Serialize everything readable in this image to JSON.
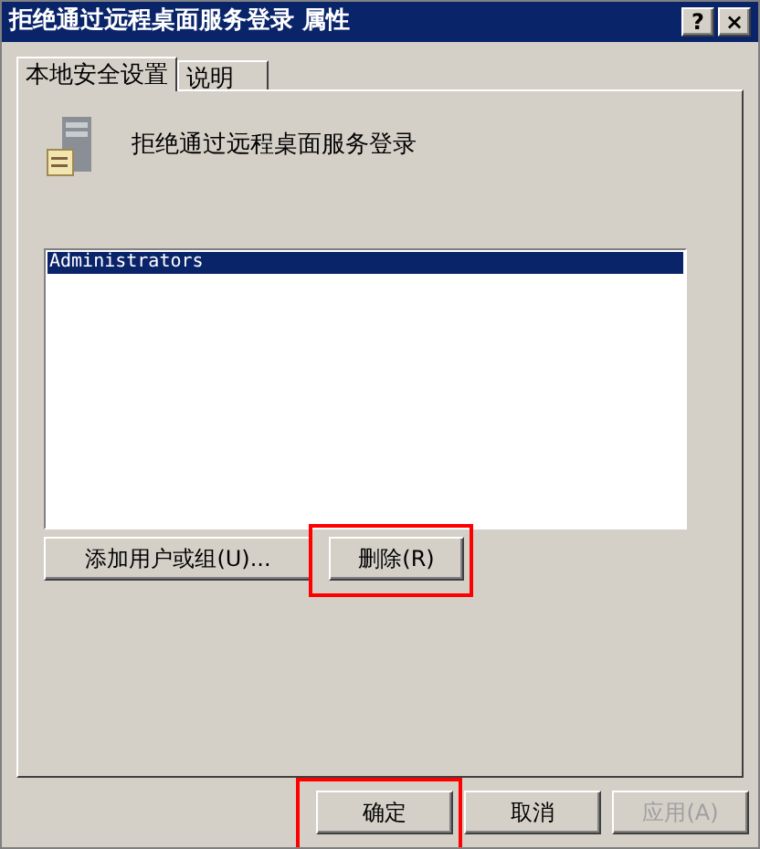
{
  "window": {
    "title": "拒绝通过远程桌面服务登录 属性",
    "controls": [
      "?",
      "×"
    ]
  },
  "tabs": [
    {
      "label": "本地安全设置",
      "selected": true
    },
    {
      "label": "说明",
      "selected": false
    }
  ],
  "policy": {
    "name": "拒绝通过远程桌面服务登录"
  },
  "members": [
    {
      "name": "Administrators",
      "selected": true
    }
  ],
  "list_buttons": [
    {
      "label": "添加用户或组(U)...",
      "highlighted": false
    },
    {
      "label": "删除(R)",
      "highlighted": true
    }
  ],
  "dialog_buttons": [
    {
      "label": "确定",
      "disabled": false,
      "highlighted": true
    },
    {
      "label": "取消",
      "disabled": false,
      "highlighted": false
    },
    {
      "label": "应用(A)",
      "disabled": true,
      "highlighted": false
    }
  ]
}
